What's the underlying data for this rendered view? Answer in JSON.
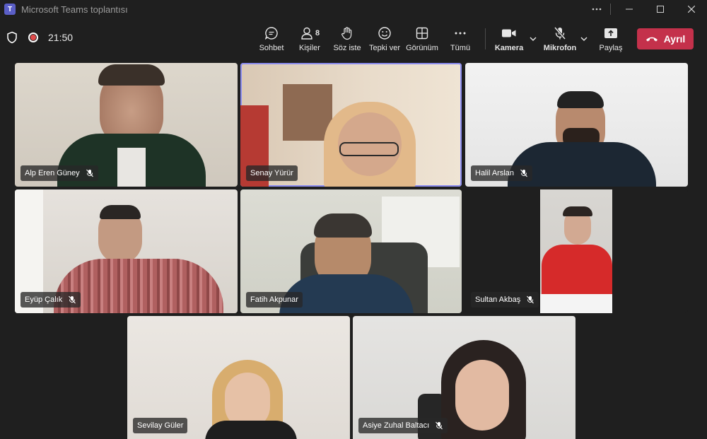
{
  "window": {
    "title": "Microsoft Teams toplantısı",
    "app_icon_letter": "T"
  },
  "toolbar": {
    "time": "21:50",
    "buttons": {
      "chat": "Sohbet",
      "people": "Kişiler",
      "people_count": "8",
      "raise_hand": "Söz iste",
      "react": "Tepki ver",
      "view": "Görünüm",
      "more": "Tümü",
      "camera": "Kamera",
      "mic": "Mikrofon",
      "share": "Paylaş"
    },
    "leave_label": "Ayrıl"
  },
  "participants": [
    {
      "name": "Alp Eren Güney",
      "muted": true
    },
    {
      "name": "Senay Yürür",
      "muted": false,
      "active": true
    },
    {
      "name": "Halil Arslan",
      "muted": true
    },
    {
      "name": "Eyüp Çalık",
      "muted": true
    },
    {
      "name": "Fatih Akpunar",
      "muted": false
    },
    {
      "name": "Sultan Akbaş",
      "muted": true
    },
    {
      "name": "Sevilay Güler",
      "muted": false
    },
    {
      "name": "Asiye Zuhal Baltacı",
      "muted": true
    }
  ],
  "colors": {
    "background": "#1f1f1f",
    "leave_button": "#c4314b",
    "active_outline": "#8b8cf0"
  }
}
